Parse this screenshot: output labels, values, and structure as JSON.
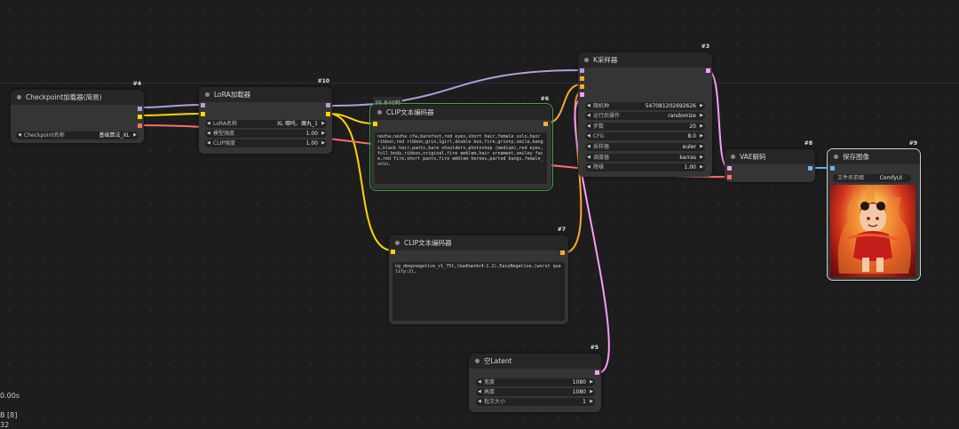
{
  "colors": {
    "clip": "#ffd500",
    "model": "#b39ddb",
    "conditioning": "#ffa931",
    "latent": "#ff9cf9",
    "vae": "#ff6e6e",
    "image": "#64b5f6"
  },
  "overlay": {
    "group_label": "35.840秒",
    "timing": "0.00s",
    "status_a": "B [8]",
    "status_b": "32"
  },
  "nodes": {
    "checkpoint": {
      "id": "#4",
      "title": "Checkpoint加载器(简易)",
      "widgets": [
        {
          "label": "Checkpoint名称",
          "value": "基础算法_XL"
        }
      ]
    },
    "lora": {
      "id": "#10",
      "title": "LoRA加载器",
      "widgets": [
        {
          "label": "LoRA名称",
          "value": "XL 哪吒、魔丸_1"
        },
        {
          "label": "模型强度",
          "value": "1.00"
        },
        {
          "label": "CLIP强度",
          "value": "1.00"
        }
      ]
    },
    "clip_pos": {
      "id": "#6",
      "title": "CLIP文本编码器",
      "text": "nezha,nezha  cfw,barefoot,red eyes,short hair,female solo,hair ribbon,red ribbon,grin,1girl,double bun,fire,grinny,smile,bangs,black hair,pants,bare shoulders,photoshop (medium),red eyes,full body,ribbon,original,fire emblem,hair ornament,smiley face,red fire,short pants,fire emblem heroes,parted bangs,female_solo,"
    },
    "clip_neg": {
      "id": "#7",
      "title": "CLIP文本编码器",
      "text": "ng_deepnegative_v1_75t,(badhandv4:1.2),EasyNegative,(worst quality:2),"
    },
    "ksampler": {
      "id": "#3",
      "title": "K采样器",
      "widgets": [
        {
          "label": "随机种",
          "value": "547081202692626"
        },
        {
          "label": "运行后操作",
          "value": "randomize"
        },
        {
          "label": "步数",
          "value": "20"
        },
        {
          "label": "CFG",
          "value": "8.0"
        },
        {
          "label": "采样器",
          "value": "euler"
        },
        {
          "label": "调度器",
          "value": "karras"
        },
        {
          "label": "降噪",
          "value": "1.00"
        }
      ]
    },
    "vae": {
      "id": "#8",
      "title": "VAE解码"
    },
    "save": {
      "id": "#9",
      "title": "保存图像",
      "widgets": [
        {
          "label": "文件名前缀",
          "value": "ComfyUI"
        }
      ]
    },
    "latent": {
      "id": "#5",
      "title": "空Latent",
      "widgets": [
        {
          "label": "宽度",
          "value": "1080"
        },
        {
          "label": "高度",
          "value": "1080"
        },
        {
          "label": "批次大小",
          "value": "1"
        }
      ]
    }
  }
}
